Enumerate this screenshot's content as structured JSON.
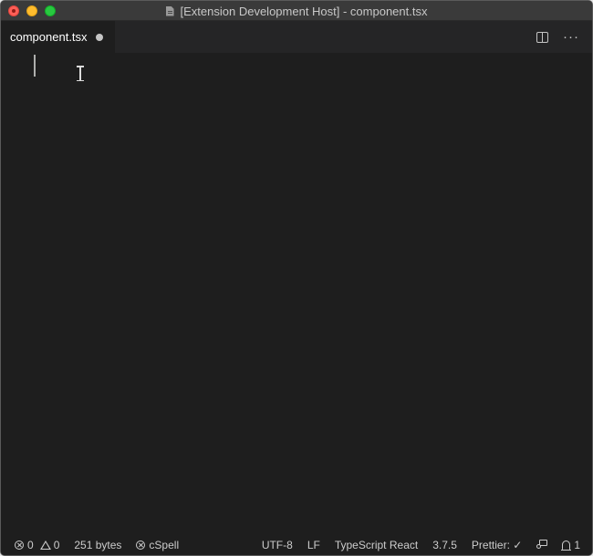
{
  "window": {
    "title": "[Extension Development Host] - component.tsx"
  },
  "tab": {
    "label": "component.tsx",
    "dirty": true
  },
  "tab_actions": {
    "split_icon": "split-editor-icon",
    "more_label": "···"
  },
  "status_bar": {
    "errors": "0",
    "warnings": "0",
    "file_size": "251 bytes",
    "spell": "cSpell",
    "encoding": "UTF-8",
    "line_ending": "LF",
    "language": "TypeScript React",
    "ts_version": "3.7.5",
    "prettier": "Prettier: ✓",
    "notifications": "1"
  },
  "colors": {
    "editor_background": "#1e1e1e",
    "titlebar": "#3a3a3a",
    "tabbar": "#252526",
    "close": "#fe5f57",
    "minimize": "#febc2e",
    "maximize": "#28c840"
  }
}
